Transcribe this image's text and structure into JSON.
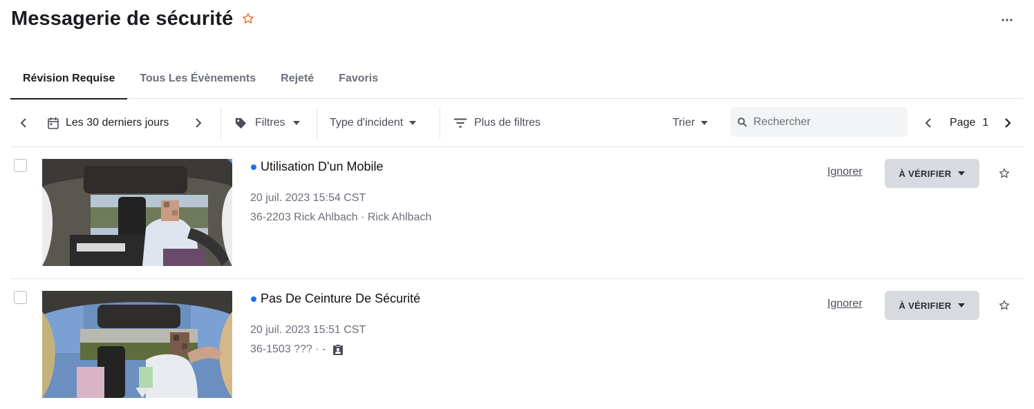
{
  "page": {
    "title": "Messagerie de sécurité",
    "accent_color": "#e8772e",
    "icons": {
      "favorite": "star-outline-icon",
      "more": "more-horizontal-icon"
    }
  },
  "tabs": [
    {
      "label": "Révision Requise",
      "active": true
    },
    {
      "label": "Tous Les Évènements",
      "active": false
    },
    {
      "label": "Rejeté",
      "active": false
    },
    {
      "label": "Favoris",
      "active": false
    }
  ],
  "toolbar": {
    "date_range": "Les 30 derniers jours",
    "filters_label": "Filtres",
    "incident_type_label": "Type d'incident",
    "more_filters_label": "Plus de filtres",
    "sort_label": "Trier",
    "search_placeholder": "Rechercher",
    "page_label": "Page",
    "page_number": "1"
  },
  "events": [
    {
      "title": "Utilisation D'un Mobile",
      "date": "20 juil. 2023 15:54 CST",
      "vehicle": "36-2203 Rick Ahlbach · Rick Ahlbach",
      "ignore_label": "Ignorer",
      "status_label": "À VÉRIFIER",
      "unread": true,
      "unread_color": "#1a73e8"
    },
    {
      "title": "Pas De Ceinture De Sécurité",
      "date": "20 juil. 2023 15:51 CST",
      "vehicle": "36-1503 ??? · -",
      "ignore_label": "Ignorer",
      "status_label": "À VÉRIFIER",
      "unread": true,
      "unread_color": "#1a73e8"
    }
  ]
}
